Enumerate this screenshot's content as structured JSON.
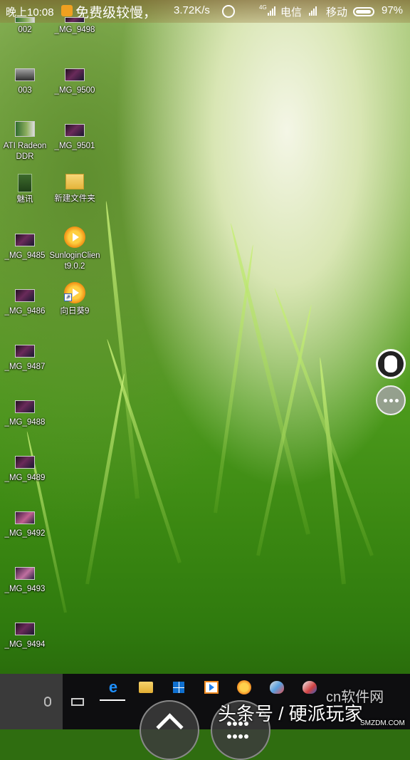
{
  "status_bar": {
    "time": "晚上10:08",
    "notification": "免费级较慢，",
    "speed": "3.72K/s",
    "carrier1": "电信",
    "network_label": "4G",
    "carrier2": "移动",
    "battery": "97%",
    "battery_level": 0.97,
    "icons": [
      "app-notification-icon",
      "alarm-icon",
      "signal-icon",
      "battery-icon"
    ]
  },
  "desktop": {
    "icons": [
      {
        "label": "002",
        "type": "pcb"
      },
      {
        "label": "_MG_9498",
        "type": "photo"
      },
      {
        "label": "003",
        "type": "card"
      },
      {
        "label": "_MG_9500",
        "type": "photo"
      },
      {
        "label": "ATI Radeon DDR",
        "type": "pcb"
      },
      {
        "label": "_MG_9501",
        "type": "photo"
      },
      {
        "label": "魅讯",
        "type": "doc"
      },
      {
        "label": "新建文件夹",
        "type": "folder"
      },
      {
        "label": "_MG_9485",
        "type": "photo"
      },
      {
        "label": "SunloginClient9.0.2",
        "type": "sunlogin"
      },
      {
        "label": "_MG_9486",
        "type": "photo"
      },
      {
        "label": "向日葵9",
        "type": "sunlogin-shortcut"
      },
      {
        "label": "_MG_9487",
        "type": "photo"
      },
      {
        "label": "_MG_9488",
        "type": "photo"
      },
      {
        "label": "_MG_9489",
        "type": "photo"
      },
      {
        "label": "_MG_9492",
        "type": "photo"
      },
      {
        "label": "_MG_9493",
        "type": "photo"
      },
      {
        "label": "_MG_9494",
        "type": "photo"
      }
    ]
  },
  "floating_buttons": [
    "mouse-mode-icon",
    "more-options-icon"
  ],
  "taskbar": {
    "icons": [
      "microphone-icon",
      "task-view-icon",
      "edge-icon",
      "file-explorer-icon",
      "store-icon",
      "media-player-icon",
      "sunlogin-icon",
      "paint-icon",
      "app-icon"
    ],
    "edge_glyph": "e"
  },
  "watermarks": {
    "main": "头条号 / 硬派玩家",
    "top": "免费级较慢，",
    "site": "SMZDM.COM",
    "partial": "cn软件网"
  }
}
